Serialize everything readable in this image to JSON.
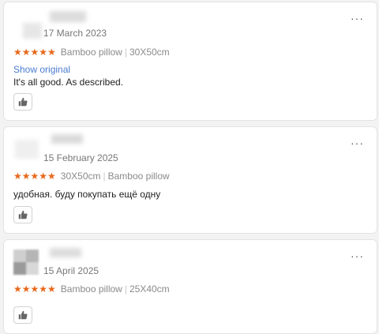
{
  "reviews": [
    {
      "date": "17 March 2023",
      "stars": "★★★★★",
      "attr1": "Bamboo pillow",
      "attr2": "30X50cm",
      "show_original": "Show original",
      "text": "It's all good. As described."
    },
    {
      "date": "15 February 2025",
      "stars": "★★★★★",
      "attr1": "30X50cm",
      "attr2": "Bamboo pillow",
      "text": "удобная. буду покупать ещё одну"
    },
    {
      "date": "15 April 2025",
      "stars": "★★★★★",
      "attr1": "Bamboo pillow",
      "attr2": "25X40cm"
    }
  ],
  "more_label": "···",
  "separator": "|",
  "colors": {
    "star": "#e8681b",
    "link": "#4a7bd0"
  },
  "icons": {
    "more": "more-options-icon",
    "like": "thumbs-up-icon"
  }
}
